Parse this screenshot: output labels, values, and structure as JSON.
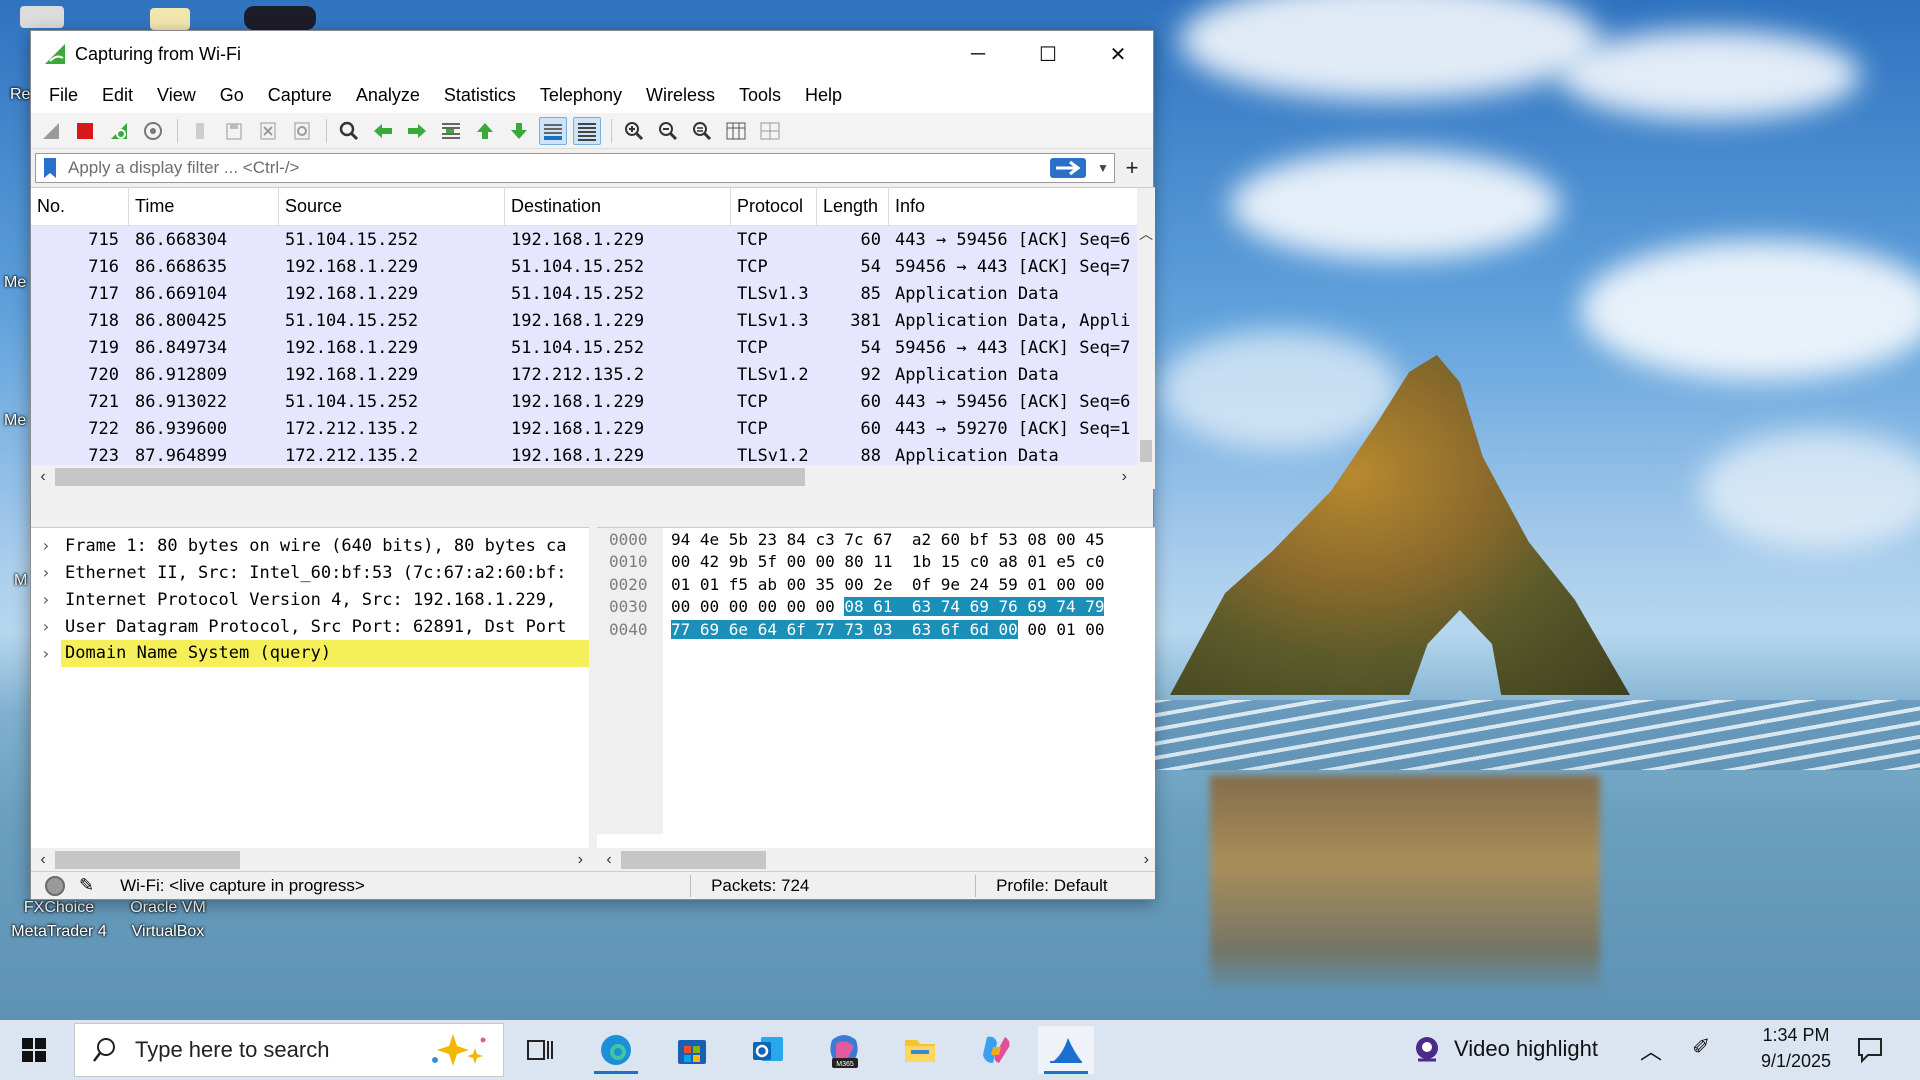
{
  "desktop": {
    "icon_labels": [
      "Re",
      "Me",
      "Me",
      "M",
      "FXChoice MetaTrader 4",
      "Oracle VM VirtualBox"
    ]
  },
  "window": {
    "title": "Capturing from Wi-Fi",
    "controls": {
      "minimize": "─",
      "maximize": "☐",
      "close": "✕"
    }
  },
  "menu": [
    "File",
    "Edit",
    "View",
    "Go",
    "Capture",
    "Analyze",
    "Statistics",
    "Telephony",
    "Wireless",
    "Tools",
    "Help"
  ],
  "toolbar": {
    "icons": [
      "start-capture-icon",
      "stop-capture-icon",
      "restart-capture-icon",
      "capture-options-icon",
      "open-file-icon",
      "save-file-icon",
      "close-file-icon",
      "reload-file-icon",
      "find-packet-icon",
      "go-back-icon",
      "go-forward-icon",
      "go-to-packet-icon",
      "go-first-icon",
      "go-last-icon",
      "autoscroll-icon",
      "colorize-icon",
      "zoom-in-icon",
      "zoom-out-icon",
      "zoom-normal-icon",
      "resize-columns-icon",
      "layout-icon"
    ]
  },
  "filter": {
    "placeholder": "Apply a display filter ... <Ctrl-/>",
    "add_label": "+"
  },
  "packet_list": {
    "columns": [
      "No.",
      "Time",
      "Source",
      "Destination",
      "Protocol",
      "Length",
      "Info"
    ],
    "rows": [
      {
        "no": "715",
        "time": "86.668304",
        "src": "51.104.15.252",
        "dst": "192.168.1.229",
        "proto": "TCP",
        "len": "60",
        "info": "443 → 59456 [ACK] Seq=6"
      },
      {
        "no": "716",
        "time": "86.668635",
        "src": "192.168.1.229",
        "dst": "51.104.15.252",
        "proto": "TCP",
        "len": "54",
        "info": "59456 → 443 [ACK] Seq=7"
      },
      {
        "no": "717",
        "time": "86.669104",
        "src": "192.168.1.229",
        "dst": "51.104.15.252",
        "proto": "TLSv1.3",
        "len": "85",
        "info": "Application Data"
      },
      {
        "no": "718",
        "time": "86.800425",
        "src": "51.104.15.252",
        "dst": "192.168.1.229",
        "proto": "TLSv1.3",
        "len": "381",
        "info": "Application Data, Appli"
      },
      {
        "no": "719",
        "time": "86.849734",
        "src": "192.168.1.229",
        "dst": "51.104.15.252",
        "proto": "TCP",
        "len": "54",
        "info": "59456 → 443 [ACK] Seq=7"
      },
      {
        "no": "720",
        "time": "86.912809",
        "src": "192.168.1.229",
        "dst": "172.212.135.2",
        "proto": "TLSv1.2",
        "len": "92",
        "info": "Application Data"
      },
      {
        "no": "721",
        "time": "86.913022",
        "src": "51.104.15.252",
        "dst": "192.168.1.229",
        "proto": "TCP",
        "len": "60",
        "info": "443 → 59456 [ACK] Seq=6"
      },
      {
        "no": "722",
        "time": "86.939600",
        "src": "172.212.135.2",
        "dst": "192.168.1.229",
        "proto": "TCP",
        "len": "60",
        "info": "443 → 59270 [ACK] Seq=1"
      },
      {
        "no": "723",
        "time": "87.964899",
        "src": "172.212.135.2",
        "dst": "192.168.1.229",
        "proto": "TLSv1.2",
        "len": "88",
        "info": "Application Data"
      },
      {
        "no": "724",
        "time": "88.019899",
        "src": "192.168.1.229",
        "dst": "172.212.135.2",
        "proto": "TCP",
        "len": "54",
        "info": "59270 → 443 [ACK] Seq=3"
      }
    ]
  },
  "packet_details": [
    "Frame 1: 80 bytes on wire (640 bits), 80 bytes ca",
    "Ethernet II, Src: Intel_60:bf:53 (7c:67:a2:60:bf:",
    "Internet Protocol Version 4, Src: 192.168.1.229,",
    "User Datagram Protocol, Src Port: 62891, Dst Port",
    "Domain Name System (query)"
  ],
  "packet_bytes": {
    "offsets": [
      "0000",
      "0010",
      "0020",
      "0030",
      "0040"
    ],
    "lines": [
      {
        "plain": "94 4e 5b 23 84 c3 7c 67  a2 60 bf 53 08 00 45",
        "hl": "",
        "tail": ""
      },
      {
        "plain": "00 42 9b 5f 00 00 80 11  1b 15 c0 a8 01 e5 c0",
        "hl": "",
        "tail": ""
      },
      {
        "plain": "01 01 f5 ab 00 35 00 2e  0f 9e 24 59 01 00 00",
        "hl": "",
        "tail": ""
      },
      {
        "plain": "00 00 00 00 00 00 ",
        "hl": "08 61  63 74 69 76 69 74 79",
        "tail": ""
      },
      {
        "plain": "",
        "hl": "77 69 6e 64 6f 77 73 03  63 6f 6d 00",
        "tail": " 00 01 00"
      }
    ]
  },
  "status": {
    "interface": "Wi-Fi: <live capture in progress>",
    "packets": "Packets: 724",
    "profile": "Profile: Default"
  },
  "taskbar": {
    "search_placeholder": "Type here to search",
    "pinned": [
      "task-view-icon",
      "edge-icon",
      "store-icon",
      "outlook-icon",
      "m365-icon",
      "file-explorer-icon",
      "copilot-icon",
      "wireshark-icon"
    ],
    "m365_badge": "M365",
    "video_highlight": "Video highlight",
    "time": "1:34 PM",
    "date": "9/1/2025"
  },
  "colors": {
    "row_bg": "#e7e6ff",
    "dns_highlight": "#f5f05a",
    "bytes_highlight": "#1a8fb8",
    "wireshark_green": "#3aa83a"
  }
}
